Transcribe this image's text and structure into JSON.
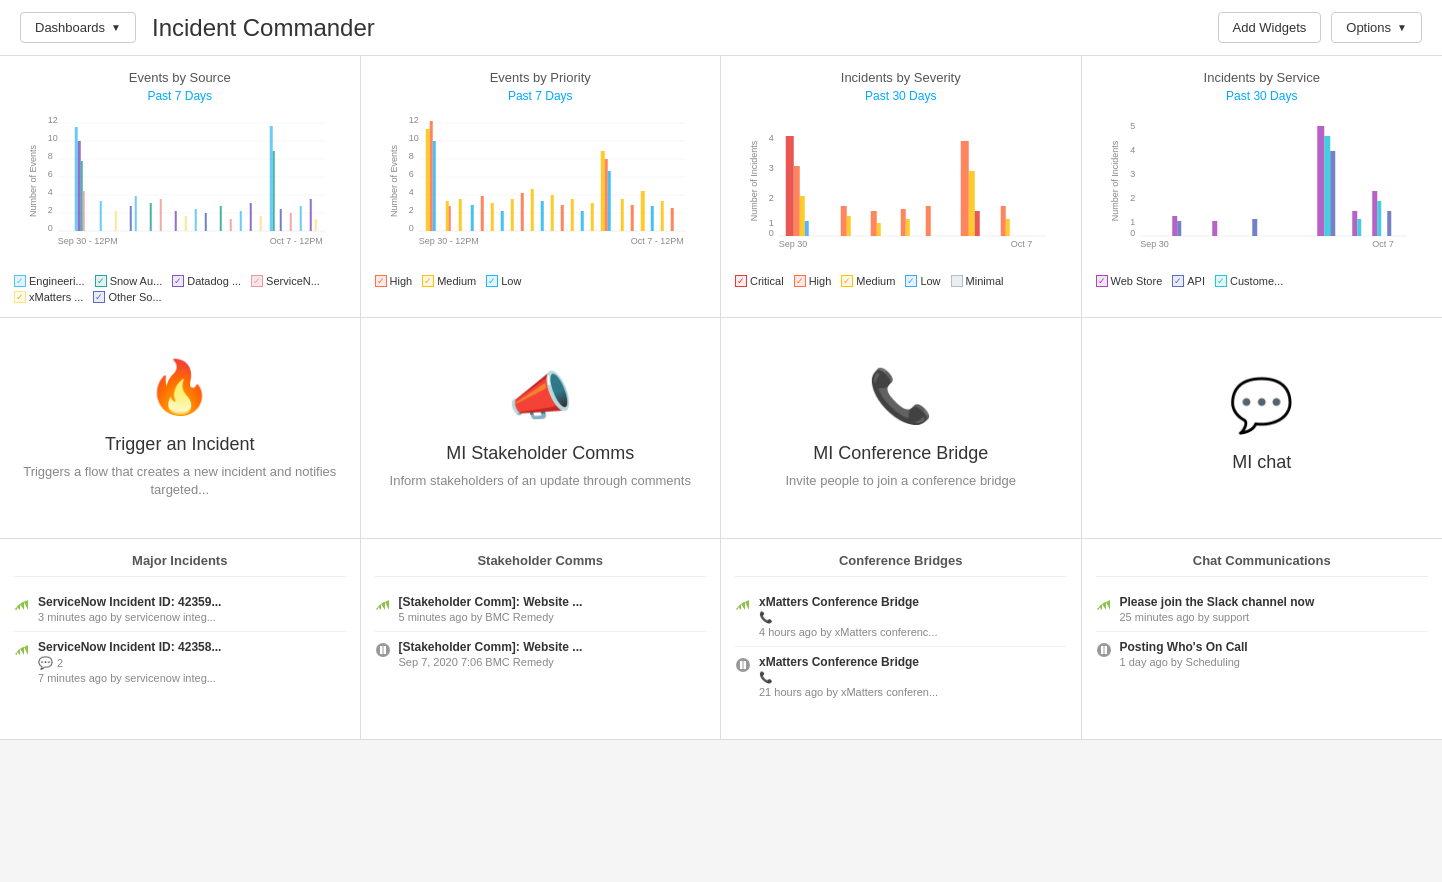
{
  "header": {
    "dashboards_label": "Dashboards",
    "title": "Incident Commander",
    "add_widgets_label": "Add Widgets",
    "options_label": "Options"
  },
  "charts": {
    "events_by_source": {
      "title": "Events by Source",
      "subtitle": "Past 7 Days",
      "x_start": "Sep 30 - 12PM",
      "x_end": "Oct 7 - 12PM",
      "y_max": 12,
      "legend": [
        {
          "label": "Engineeri...",
          "color": "#4fc3f7",
          "checked": true
        },
        {
          "label": "Snow Au...",
          "color": "#26a69a",
          "checked": true
        },
        {
          "label": "Datadog ...",
          "color": "#7e57c2",
          "checked": true
        },
        {
          "label": "ServiceN...",
          "color": "#ef9a9a",
          "checked": true
        },
        {
          "label": "xMatters ...",
          "color": "#ffe082",
          "checked": true
        },
        {
          "label": "Other So...",
          "color": "#5c6bc0",
          "checked": true
        }
      ]
    },
    "events_by_priority": {
      "title": "Events by Priority",
      "subtitle": "Past 7 Days",
      "x_start": "Sep 30 - 12PM",
      "x_end": "Oct 7 - 12PM",
      "y_max": 12,
      "legend": [
        {
          "label": "High",
          "color": "#ff7043",
          "checked": true
        },
        {
          "label": "Medium",
          "color": "#ffc107",
          "checked": true
        },
        {
          "label": "Low",
          "color": "#29b6f6",
          "checked": true
        }
      ]
    },
    "incidents_by_severity": {
      "title": "Incidents by Severity",
      "subtitle": "Past 30 Days",
      "x_start": "Sep 30",
      "x_end": "Oct 7",
      "y_max": 4,
      "legend": [
        {
          "label": "Critical",
          "color": "#e53935",
          "checked": true
        },
        {
          "label": "High",
          "color": "#ff7043",
          "checked": true
        },
        {
          "label": "Medium",
          "color": "#ffc107",
          "checked": true
        },
        {
          "label": "Low",
          "color": "#42a5f5",
          "checked": true
        },
        {
          "label": "Minimal",
          "color": "#b0bec5",
          "checked": false
        }
      ]
    },
    "incidents_by_service": {
      "title": "Incidents by Service",
      "subtitle": "Past 30 Days",
      "x_start": "Sep 30",
      "x_end": "Oct 7",
      "y_max": 5,
      "legend": [
        {
          "label": "Web Store",
          "color": "#ab47bc",
          "checked": true
        },
        {
          "label": "API",
          "color": "#5c6bc0",
          "checked": true
        },
        {
          "label": "Custome...",
          "color": "#26c6da",
          "checked": true
        }
      ]
    }
  },
  "actions": [
    {
      "id": "trigger",
      "icon": "🔥",
      "icon_color": "#e91e8c",
      "title": "Trigger an Incident",
      "desc": "Triggers a flow that creates a new incident and notifies targeted..."
    },
    {
      "id": "stakeholder",
      "icon": "📣",
      "icon_color": "#9c27b0",
      "title": "MI Stakeholder Comms",
      "desc": "Inform stakeholders of an update through comments"
    },
    {
      "id": "conference",
      "icon": "📞",
      "icon_color": "#26c6da",
      "title": "MI Conference Bridge",
      "desc": "Invite people to join a conference bridge"
    },
    {
      "id": "chat",
      "icon": "💬",
      "icon_color": "#ef5350",
      "title": "MI chat",
      "desc": ""
    }
  ],
  "feeds": {
    "major_incidents": {
      "title": "Major Incidents",
      "items": [
        {
          "status": "active",
          "main": "ServiceNow Incident ID: 42359...",
          "meta": "3 minutes ago by servicenow integ...",
          "has_badge": false
        },
        {
          "status": "active",
          "main": "ServiceNow Incident ID: 42358...",
          "meta": "7 minutes ago by servicenow integ...",
          "has_badge": true,
          "badge_count": "2"
        }
      ]
    },
    "stakeholder_comms": {
      "title": "Stakeholder Comms",
      "items": [
        {
          "status": "active",
          "main": "[Stakeholder Comm]: Website ...",
          "meta": "5 minutes ago by BMC Remedy",
          "has_badge": false
        },
        {
          "status": "paused",
          "main": "[Stakeholder Comm]: Website ...",
          "meta": "Sep 7, 2020 7:06 BMC Remedy",
          "has_badge": false
        }
      ]
    },
    "conference_bridges": {
      "title": "Conference Bridges",
      "items": [
        {
          "status": "active",
          "main": "xMatters Conference Bridge",
          "sub_icon": "📞",
          "meta": "4 hours ago by xMatters conferenc...",
          "has_badge": false
        },
        {
          "status": "paused",
          "main": "xMatters Conference Bridge",
          "sub_icon": "📞",
          "meta": "21 hours ago by xMatters conferen...",
          "has_badge": false
        }
      ]
    },
    "chat_communications": {
      "title": "Chat Communications",
      "items": [
        {
          "status": "active",
          "main": "Please join the Slack channel now",
          "meta": "25 minutes ago by support",
          "has_badge": false
        },
        {
          "status": "paused",
          "main": "Posting Who's On Call",
          "meta": "1 day ago by Scheduling",
          "has_badge": false
        }
      ]
    }
  }
}
